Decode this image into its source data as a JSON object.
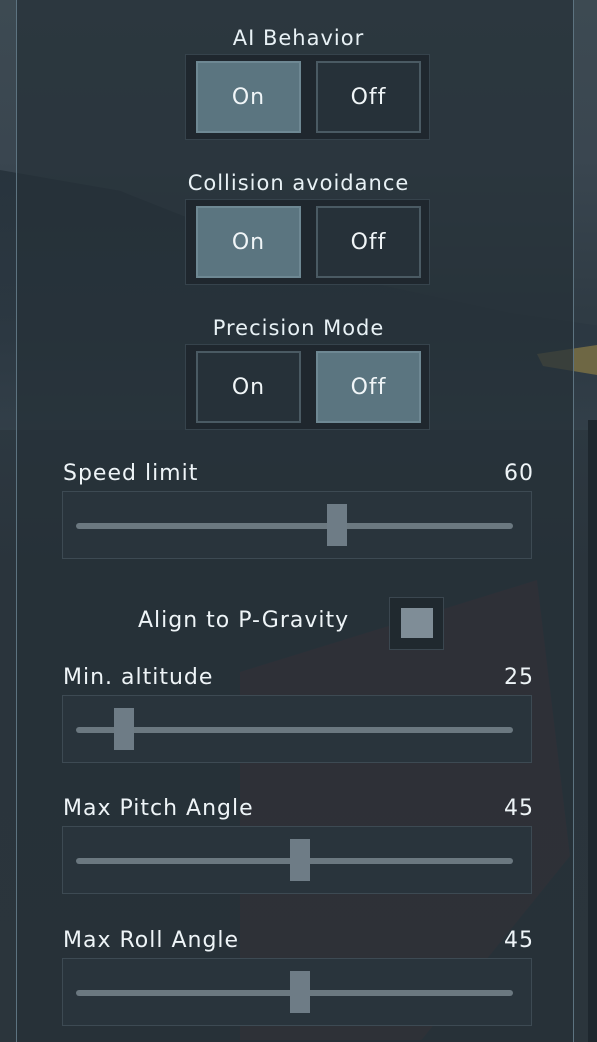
{
  "toggles": [
    {
      "title": "AI Behavior",
      "on_label": "On",
      "off_label": "Off",
      "selected": "on"
    },
    {
      "title": "Collision avoidance",
      "on_label": "On",
      "off_label": "Off",
      "selected": "on"
    },
    {
      "title": "Precision Mode",
      "on_label": "On",
      "off_label": "Off",
      "selected": "off"
    }
  ],
  "sliders": {
    "speed_limit": {
      "label": "Speed limit",
      "value": "60",
      "fraction": 0.6
    },
    "min_altitude": {
      "label": "Min. altitude",
      "value": "25",
      "fraction": 0.09
    },
    "max_pitch_angle": {
      "label": "Max Pitch Angle",
      "value": "45",
      "fraction": 0.51
    },
    "max_roll_angle": {
      "label": "Max Roll Angle",
      "value": "45",
      "fraction": 0.51
    }
  },
  "align_gravity": {
    "label": "Align to P-Gravity",
    "checked": true
  }
}
